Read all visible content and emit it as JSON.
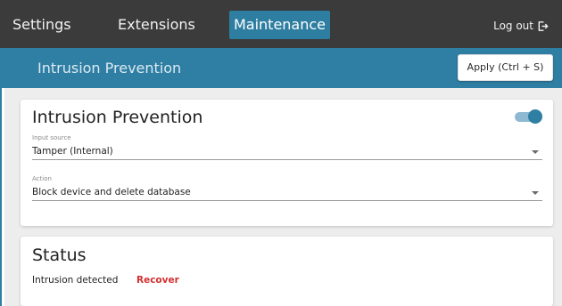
{
  "nav": {
    "tabs": [
      {
        "label": "Settings",
        "active": false
      },
      {
        "label": "Extensions",
        "active": false
      },
      {
        "label": "Maintenance",
        "active": true
      }
    ],
    "logout_label": "Log out",
    "logout_icon": "logout-icon"
  },
  "header": {
    "title": "Intrusion Prevention",
    "apply_label": "Apply (Ctrl + S)"
  },
  "intrusion_card": {
    "title": "Intrusion Prevention",
    "enabled": true,
    "input_source": {
      "label": "Input source",
      "value": "Tamper (Internal)"
    },
    "action": {
      "label": "Action",
      "value": "Block device and delete database"
    }
  },
  "status_card": {
    "title": "Status",
    "status_text": "Intrusion detected",
    "recover_label": "Recover"
  },
  "colors": {
    "topbar_bg": "#3b3b3b",
    "accent": "#2f7ea3",
    "active_tab": "#2e7ea1",
    "danger": "#d32f2f",
    "page_bg": "#ededed"
  }
}
